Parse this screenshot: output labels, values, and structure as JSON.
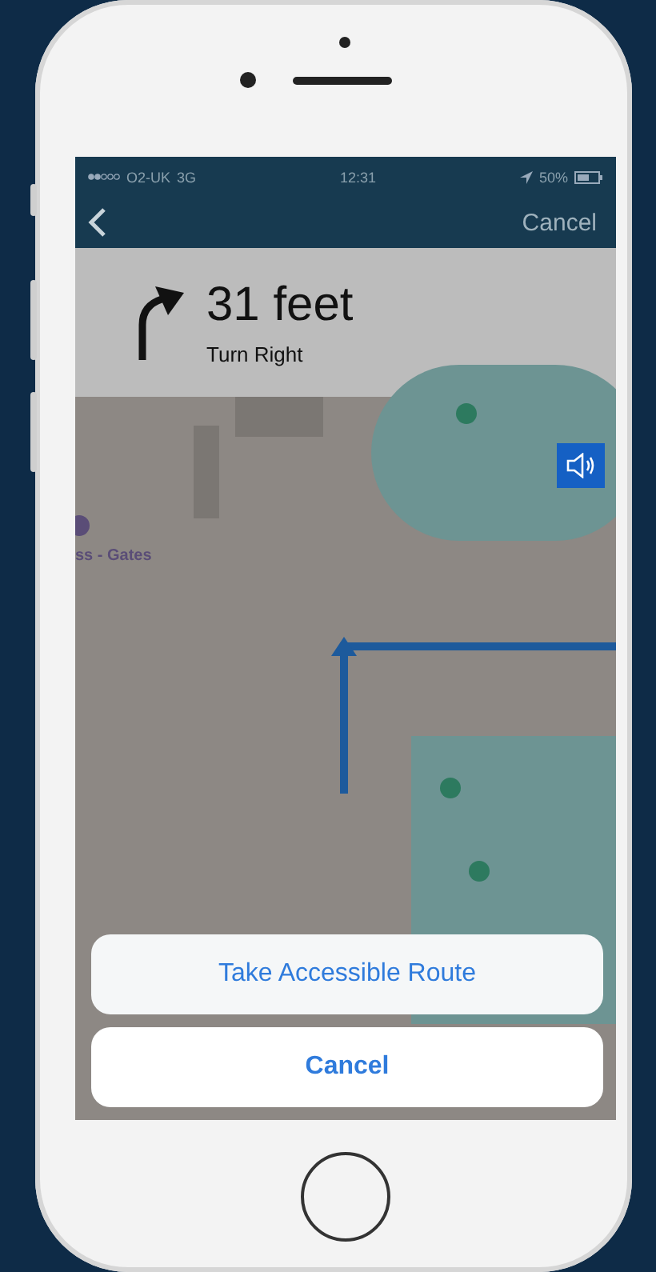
{
  "status_bar": {
    "carrier": "O2-UK",
    "network": "3G",
    "time": "12:31",
    "battery": "50%"
  },
  "nav": {
    "cancel": "Cancel"
  },
  "direction": {
    "distance": "31 feet",
    "instruction": "Turn Right"
  },
  "map": {
    "place_label": "ss - Gates"
  },
  "action_sheet": {
    "buttons": [
      {
        "label": "Take Accessible Route",
        "kind": "action"
      },
      {
        "label": "Cancel",
        "kind": "cancel"
      }
    ]
  }
}
